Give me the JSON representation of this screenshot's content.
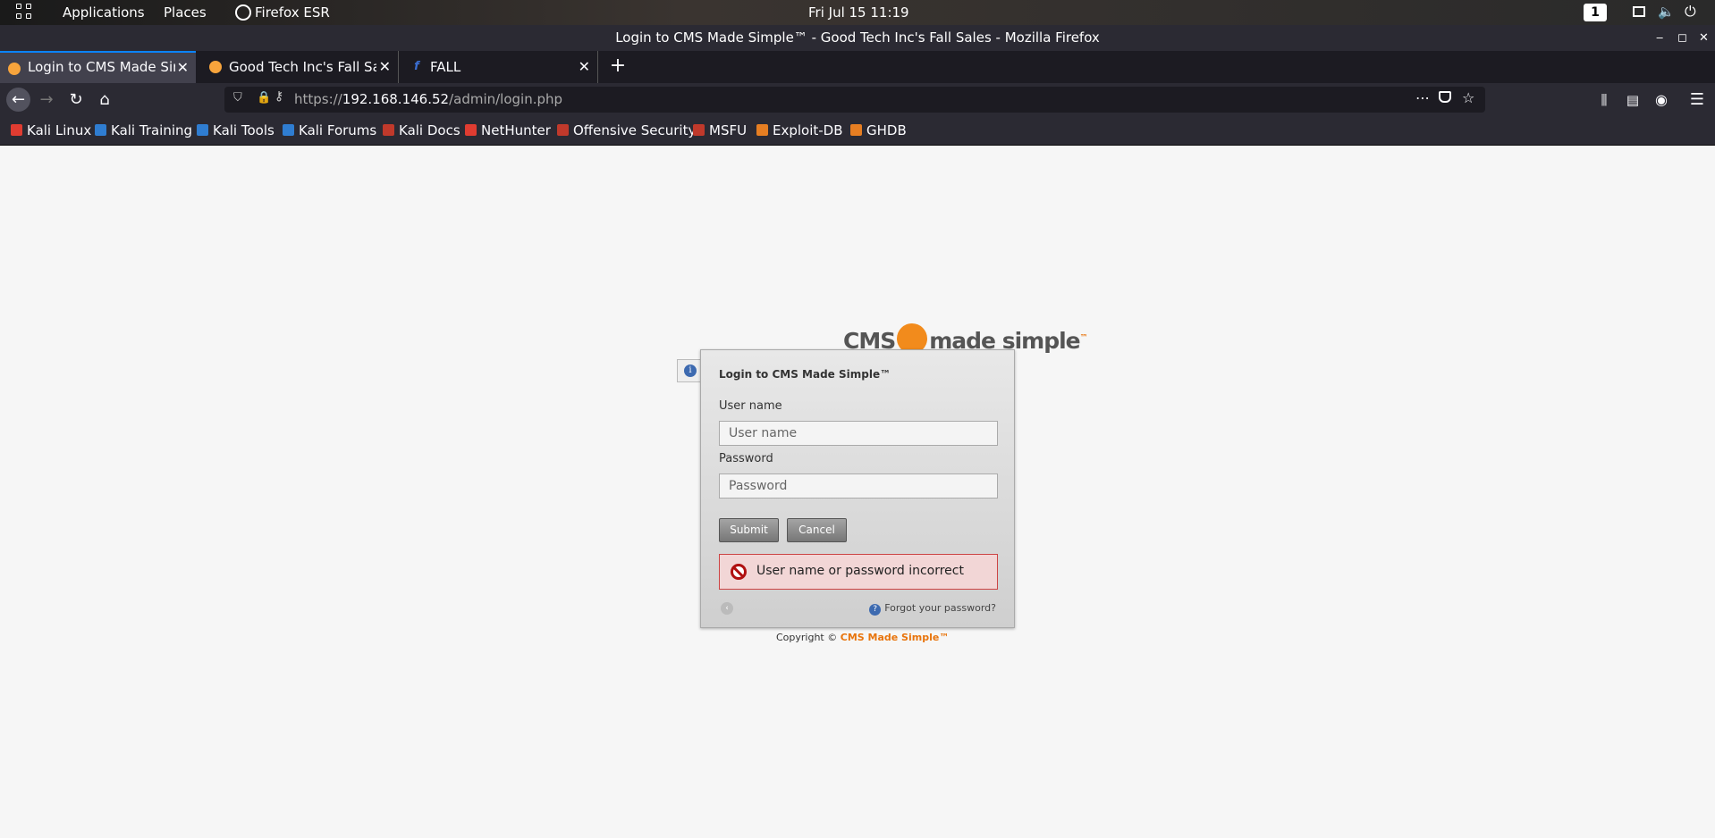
{
  "os_bar": {
    "applications": "Applications",
    "places": "Places",
    "browser": "Firefox ESR",
    "clock": "Fri Jul 15  11:19",
    "workspace": "1"
  },
  "window": {
    "title": "Login to CMS Made Simple™ - Good Tech Inc's Fall Sales - Mozilla Firefox"
  },
  "tabs": [
    {
      "label": "Login to CMS Made Simple™"
    },
    {
      "label": "Good Tech Inc's Fall Sales"
    },
    {
      "label": "FALL"
    }
  ],
  "address": {
    "scheme": "https://",
    "host": "192.168.146.52",
    "path": "/admin/login.php"
  },
  "bookmarks": [
    {
      "label": "Kali Linux",
      "color": "#e03c31"
    },
    {
      "label": "Kali Training",
      "color": "#2f7dd1"
    },
    {
      "label": "Kali Tools",
      "color": "#2f7dd1"
    },
    {
      "label": "Kali Forums",
      "color": "#2f7dd1"
    },
    {
      "label": "Kali Docs",
      "color": "#c0392b"
    },
    {
      "label": "NetHunter",
      "color": "#e03c31"
    },
    {
      "label": "Offensive Security",
      "color": "#c0392b"
    },
    {
      "label": "MSFU",
      "color": "#c0392b"
    },
    {
      "label": "Exploit-DB",
      "color": "#e67e22"
    },
    {
      "label": "GHDB",
      "color": "#e67e22"
    }
  ],
  "login": {
    "logo_left": "CMS",
    "logo_right": "made simple",
    "logo_tm": "™",
    "heading": "Login to CMS Made Simple™",
    "username_label": "User name",
    "username_placeholder": "User name",
    "password_label": "Password",
    "password_placeholder": "Password",
    "submit": "Submit",
    "cancel": "Cancel",
    "error": "User name or password incorrect",
    "forgot": "Forgot your password?",
    "copyright_prefix": "Copyright © ",
    "copyright_brand": "CMS Made Simple™"
  }
}
